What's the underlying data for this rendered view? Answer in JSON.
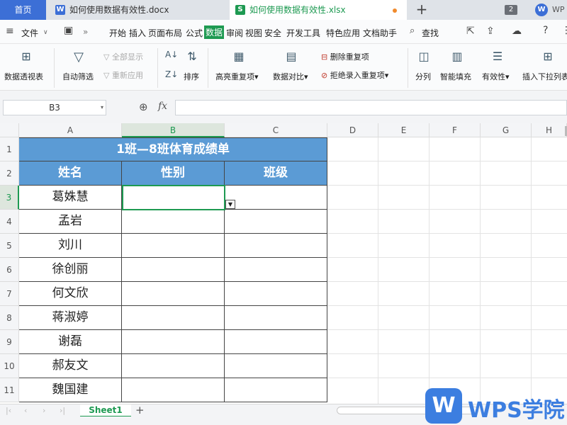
{
  "tabs": {
    "home": "首页",
    "doc": "如何使用数据有效性.docx",
    "xls": "如何使用数据有效性.xlsx",
    "count": "2",
    "user": "WP"
  },
  "menu": {
    "file": "文件",
    "items": [
      "开始",
      "插入",
      "页面布局",
      "公式",
      "数据",
      "审阅",
      "视图",
      "安全",
      "开发工具",
      "特色应用",
      "文档助手"
    ],
    "search": "查找"
  },
  "ribbon": {
    "pivot": "数据透视表",
    "autofilter": "自动筛选",
    "show_all": "全部显示",
    "reapply": "重新应用",
    "sort": "排序",
    "highlight_dup": "高亮重复项",
    "compare": "数据对比",
    "delete_dup": "删除重复项",
    "reject_dup": "拒绝录入重复项",
    "split": "分列",
    "smart_fill": "智能填充",
    "validity": "有效性",
    "insert_dropdown": "插入下拉列表"
  },
  "formula_bar": {
    "name_box": "B3",
    "fx": "fx",
    "value": ""
  },
  "columns": [
    "A",
    "B",
    "C",
    "D",
    "E",
    "F",
    "G",
    "H"
  ],
  "rows": [
    "1",
    "2",
    "3",
    "4",
    "5",
    "6",
    "7",
    "8",
    "9",
    "10",
    "11"
  ],
  "table": {
    "title": "1班—8班体育成绩单",
    "headers": [
      "姓名",
      "性别",
      "班级"
    ],
    "names": [
      "葛姝慧",
      "孟岩",
      "刘川",
      "徐创丽",
      "何文欣",
      "蒋淑婷",
      "谢磊",
      "郝友文",
      "魏国建"
    ]
  },
  "sheets": [
    "Sheet1"
  ],
  "watermark": "WPS学院",
  "colors": {
    "accent": "#1e9a52",
    "header_fill": "#5b9bd5",
    "home_tab": "#3c6fd6"
  }
}
